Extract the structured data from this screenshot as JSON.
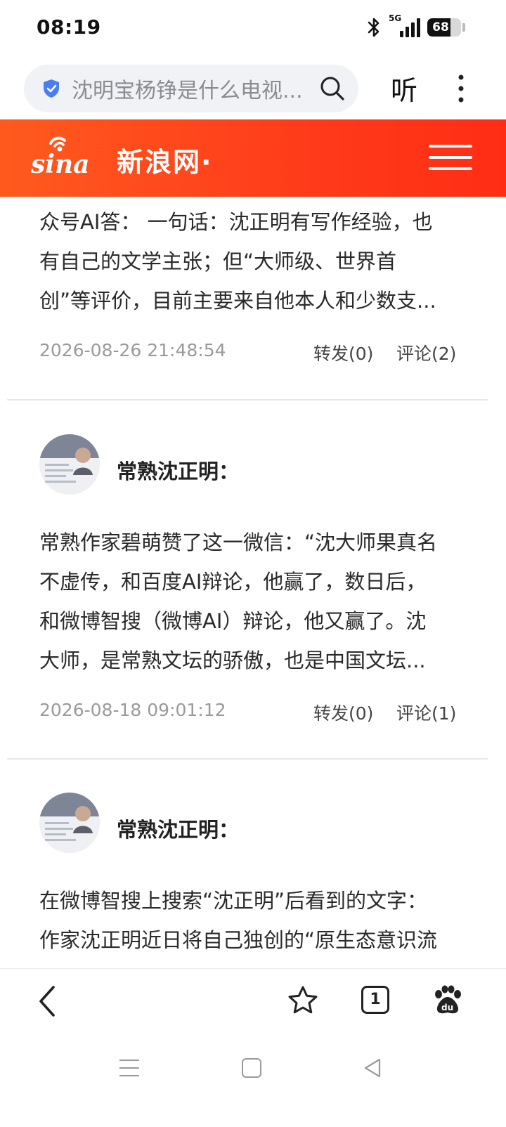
{
  "status_bar": {
    "time": "08:19",
    "network": "5G",
    "battery": "68"
  },
  "browser": {
    "search_text": "沈明宝杨铮是什么电视...",
    "listen_label": "听"
  },
  "sina": {
    "title": "新浪网·",
    "logo_text": "sina"
  },
  "posts": [
    {
      "lines": [
        "众号AI答： 一句话：沈正明有写作经验，也",
        "有自己的文学主张；但“大师级、世界首",
        "创”等评价，目前主要来自他本人和少数支..."
      ],
      "date": "2026-08-26 21:48:54",
      "forward": "转发(0)",
      "comment": "评论(2)"
    },
    {
      "author": "常熟沈正明：",
      "lines": [
        "常熟作家碧萌赞了这一微信：“沈大师果真名",
        "不虚传，和百度AI辩论，他赢了，数日后，",
        "和微博智搜（微博AI）辩论，他又赢了。沈",
        "大师，是常熟文坛的骄傲，也是中国文坛..."
      ],
      "date": "2026-08-18 09:01:12",
      "forward": "转发(0)",
      "comment": "评论(1)"
    },
    {
      "author": "常熟沈正明：",
      "lines": [
        "在微博智搜上搜索“沈正明”后看到的文字：",
        "作家沈正明近日将自己独创的“原生态意识流"
      ]
    }
  ],
  "bottom_nav": {
    "tab_count": "1"
  },
  "colors": {
    "brand": "#ff3b1a",
    "shield": "#4a7cf5"
  }
}
